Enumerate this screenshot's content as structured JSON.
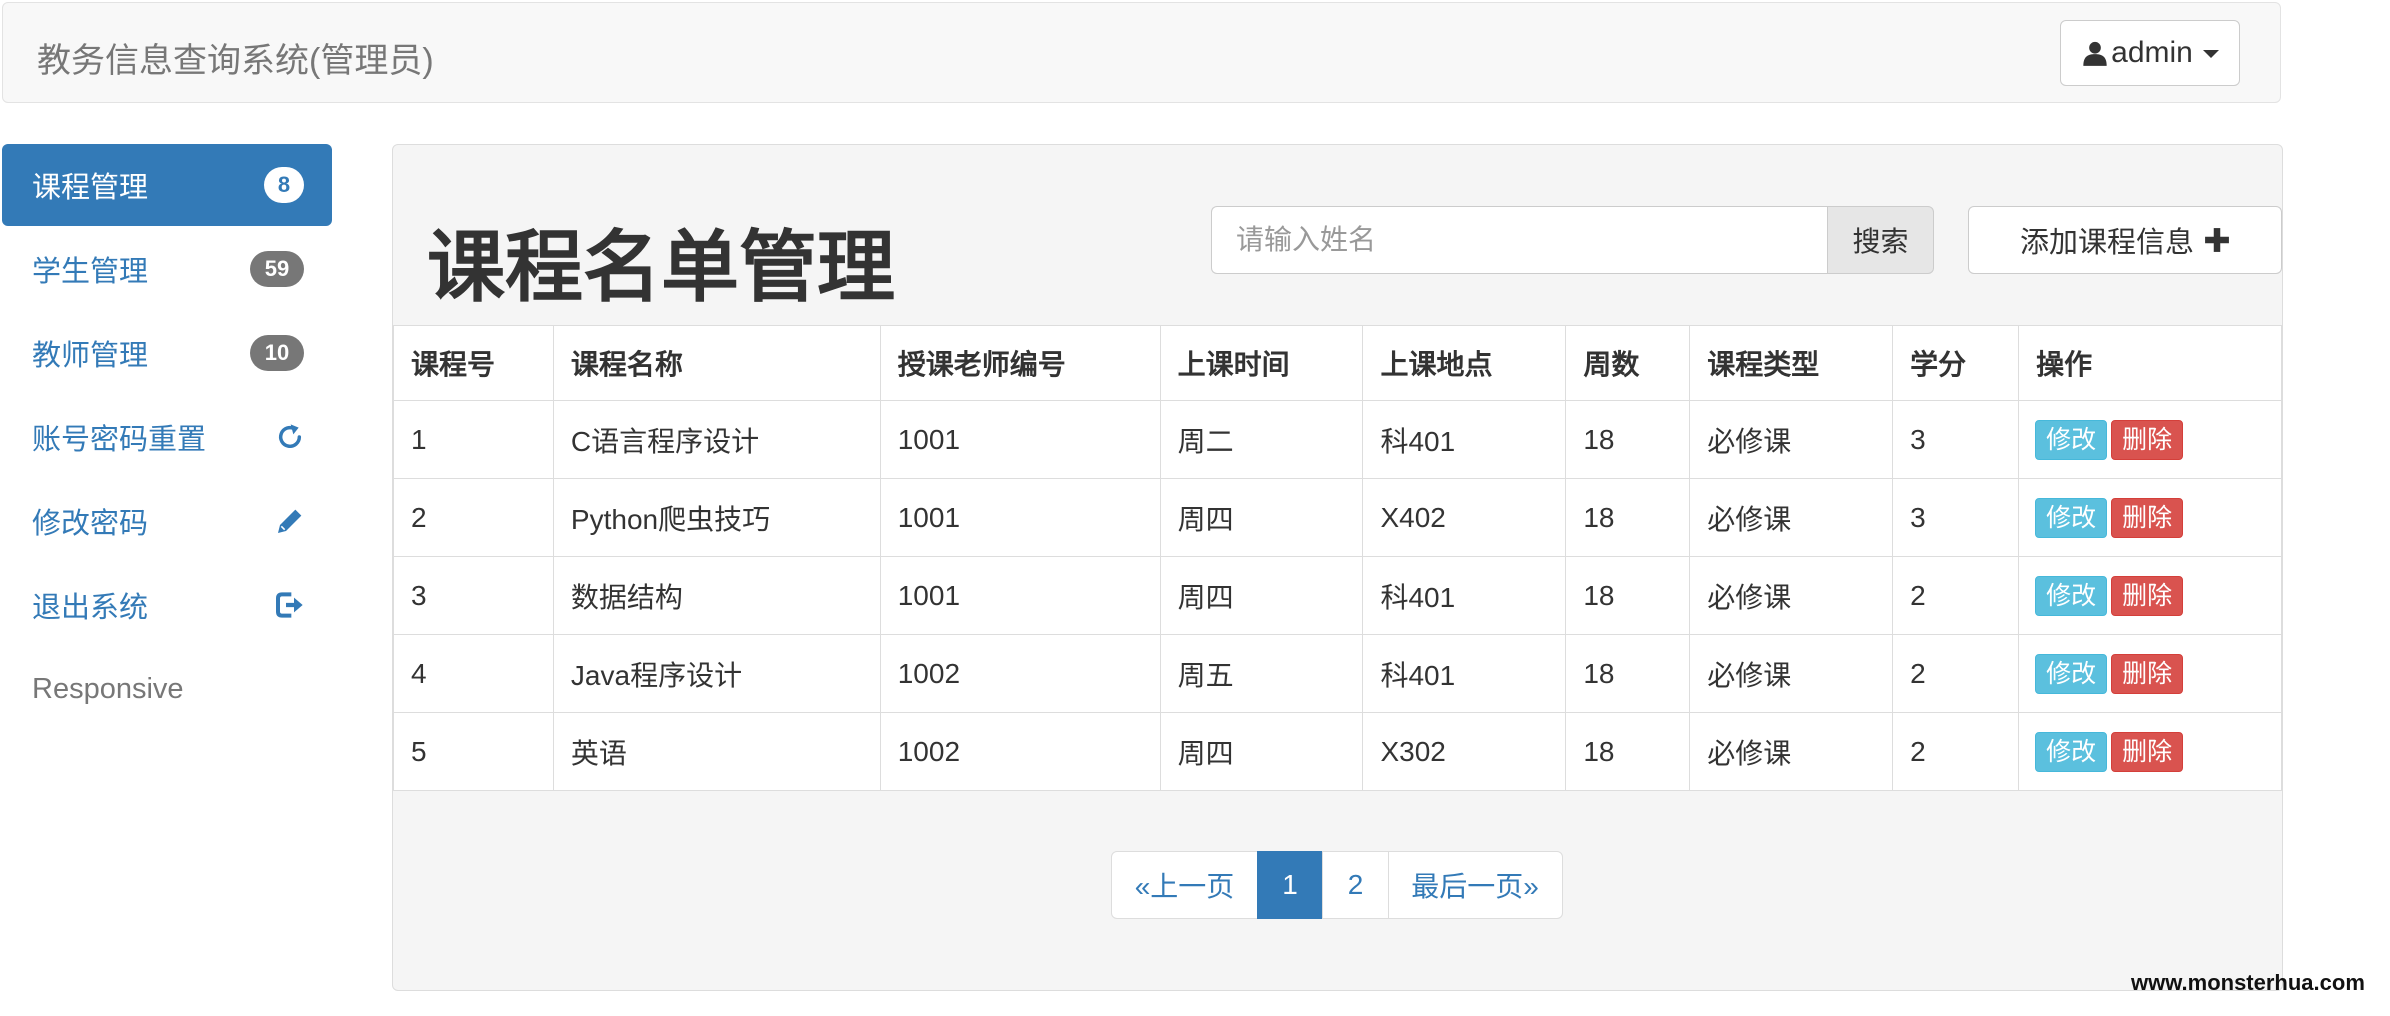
{
  "app": {
    "title": "教务信息查询系统(管理员)"
  },
  "user_menu": {
    "label": "admin"
  },
  "sidebar": {
    "items": [
      {
        "label": "课程管理",
        "badge": "8"
      },
      {
        "label": "学生管理",
        "badge": "59"
      },
      {
        "label": "教师管理",
        "badge": "10"
      },
      {
        "label": "账号密码重置",
        "icon": "refresh-icon"
      },
      {
        "label": "修改密码",
        "icon": "pencil-icon"
      },
      {
        "label": "退出系统",
        "icon": "logout-icon"
      },
      {
        "label": "Responsive"
      }
    ]
  },
  "main": {
    "title": "课程名单管理",
    "search": {
      "placeholder": "请输入姓名",
      "button": "搜索"
    },
    "add_button": "添加课程信息"
  },
  "table": {
    "headers": [
      "课程号",
      "课程名称",
      "授课老师编号",
      "上课时间",
      "上课地点",
      "周数",
      "课程类型",
      "学分",
      "操作"
    ],
    "rows": [
      [
        "1",
        "C语言程序设计",
        "1001",
        "周二",
        "科401",
        "18",
        "必修课",
        "3"
      ],
      [
        "2",
        "Python爬虫技巧",
        "1001",
        "周四",
        "X402",
        "18",
        "必修课",
        "3"
      ],
      [
        "3",
        "数据结构",
        "1001",
        "周四",
        "科401",
        "18",
        "必修课",
        "2"
      ],
      [
        "4",
        "Java程序设计",
        "1002",
        "周五",
        "科401",
        "18",
        "必修课",
        "2"
      ],
      [
        "5",
        "英语",
        "1002",
        "周四",
        "X302",
        "18",
        "必修课",
        "2"
      ]
    ],
    "action_edit": "修改",
    "action_delete": "删除"
  },
  "pagination": {
    "prev": "«上一页",
    "pages": [
      "1",
      "2"
    ],
    "active_page": "1",
    "last": "最后一页»"
  },
  "watermark": "www.monsterhua.com",
  "colors": {
    "primary": "#337ab7",
    "info": "#5bc0de",
    "danger": "#d9534f",
    "badge": "#777777"
  }
}
